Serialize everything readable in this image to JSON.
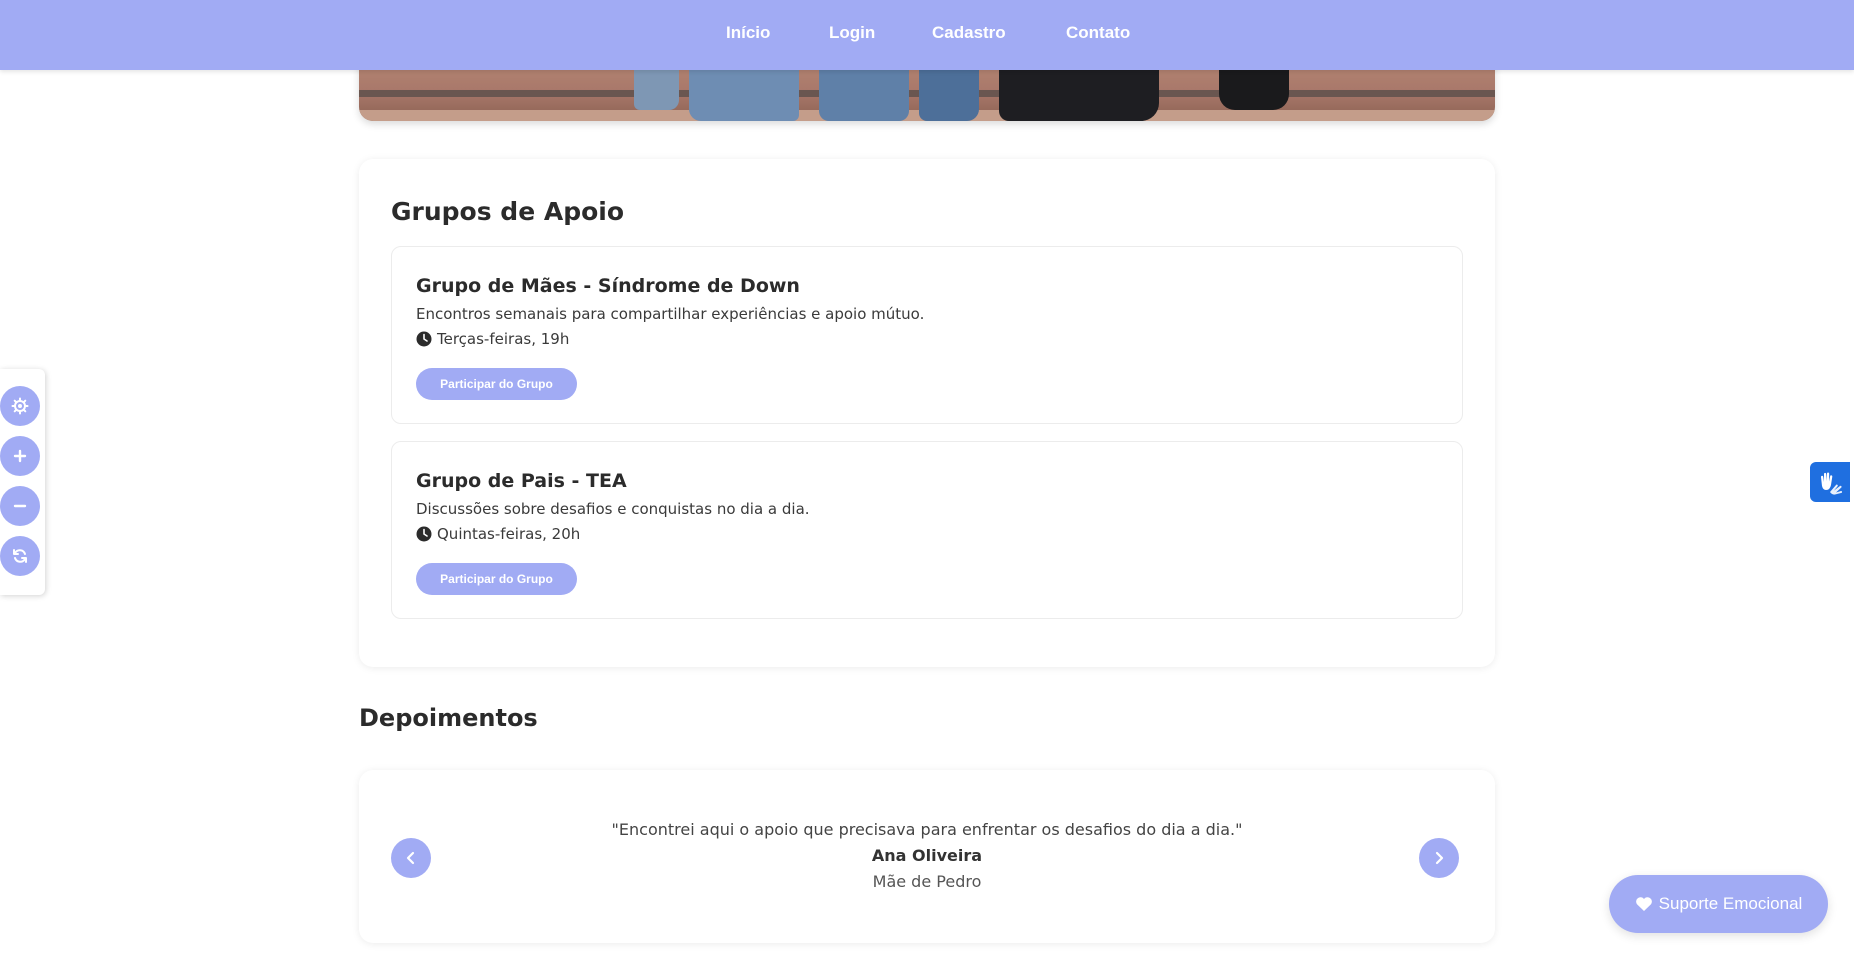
{
  "nav": {
    "items": [
      {
        "label": "Início"
      },
      {
        "label": "Login"
      },
      {
        "label": "Cadastro"
      },
      {
        "label": "Contato"
      }
    ]
  },
  "groups_section": {
    "title": "Grupos de Apoio",
    "groups": [
      {
        "title": "Grupo de Mães - Síndrome de Down",
        "description": "Encontros semanais para compartilhar experiências e apoio mútuo.",
        "schedule": "Terças-feiras, 19h",
        "button_label": "Participar do Grupo"
      },
      {
        "title": "Grupo de Pais - TEA",
        "description": "Discussões sobre desafios e conquistas no dia a dia.",
        "schedule": "Quintas-feiras, 20h",
        "button_label": "Participar do Grupo"
      }
    ]
  },
  "testimonials": {
    "title": "Depoimentos",
    "quote": "\"Encontrei aqui o apoio que precisava para enfrentar os desafios do dia a dia.\"",
    "author": "Ana Oliveira",
    "role": "Mãe de Pedro"
  },
  "toolbar": {
    "icons": [
      "gear-icon",
      "plus-icon",
      "minus-icon",
      "refresh-icon"
    ]
  },
  "support_button": {
    "label": "Suporte Emocional"
  },
  "colors": {
    "accent": "#a1abf4",
    "vlibras": "#1f6fe0",
    "text": "#2b2b2b"
  }
}
